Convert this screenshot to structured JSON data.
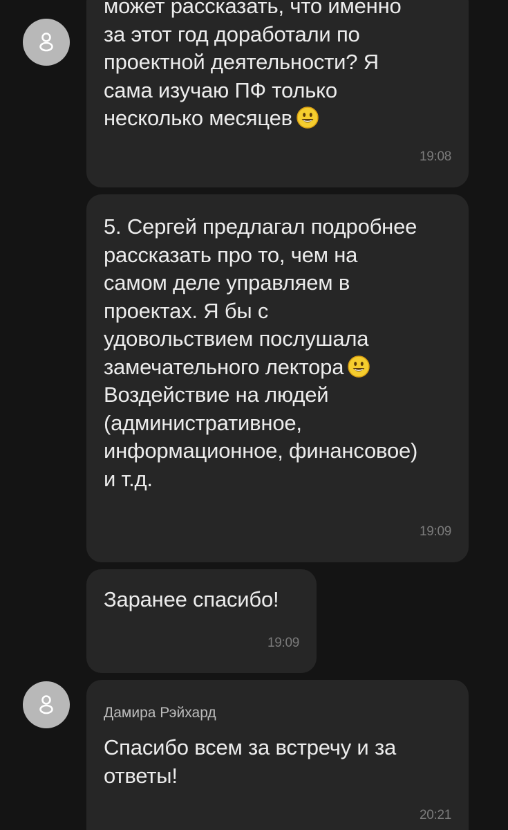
{
  "messages": [
    {
      "id": "m1",
      "lines": [
        "может рассказать, что именно",
        "за этот год доработали по",
        "проектной деятельности? Я",
        "сама изучаю ПФ только",
        "несколько месяцев"
      ],
      "emoji": "smile-emoji",
      "time": "19:08"
    },
    {
      "id": "m2",
      "lines": [
        "5. Сергей предлагал подробнее",
        "рассказать про то, чем на",
        "самом деле управляем в",
        "проектах. Я бы с",
        "удовольствием послушала",
        "замечательного лектора",
        "Воздействие на людей",
        "(административное,",
        "информационное, финансовое)",
        "и т.д."
      ],
      "emoji": "smile-emoji",
      "time": "19:09"
    },
    {
      "id": "m3",
      "lines": [
        "Заранее спасибо!"
      ],
      "time": "19:09"
    },
    {
      "id": "m4",
      "sender": "Дамира Рэйхард",
      "lines": [
        "Спасибо всем за встречу и за",
        "ответы!"
      ],
      "time": "20:21"
    }
  ],
  "colors": {
    "background": "#141414",
    "bubble": "#262626",
    "avatar": "#b8b8b8",
    "text": "#ececec",
    "time": "#7b7b7b",
    "emoji": "#f5cd2e"
  },
  "icons": {
    "avatar": "person-placeholder-icon",
    "emoji": "smiling-face-emoji"
  }
}
